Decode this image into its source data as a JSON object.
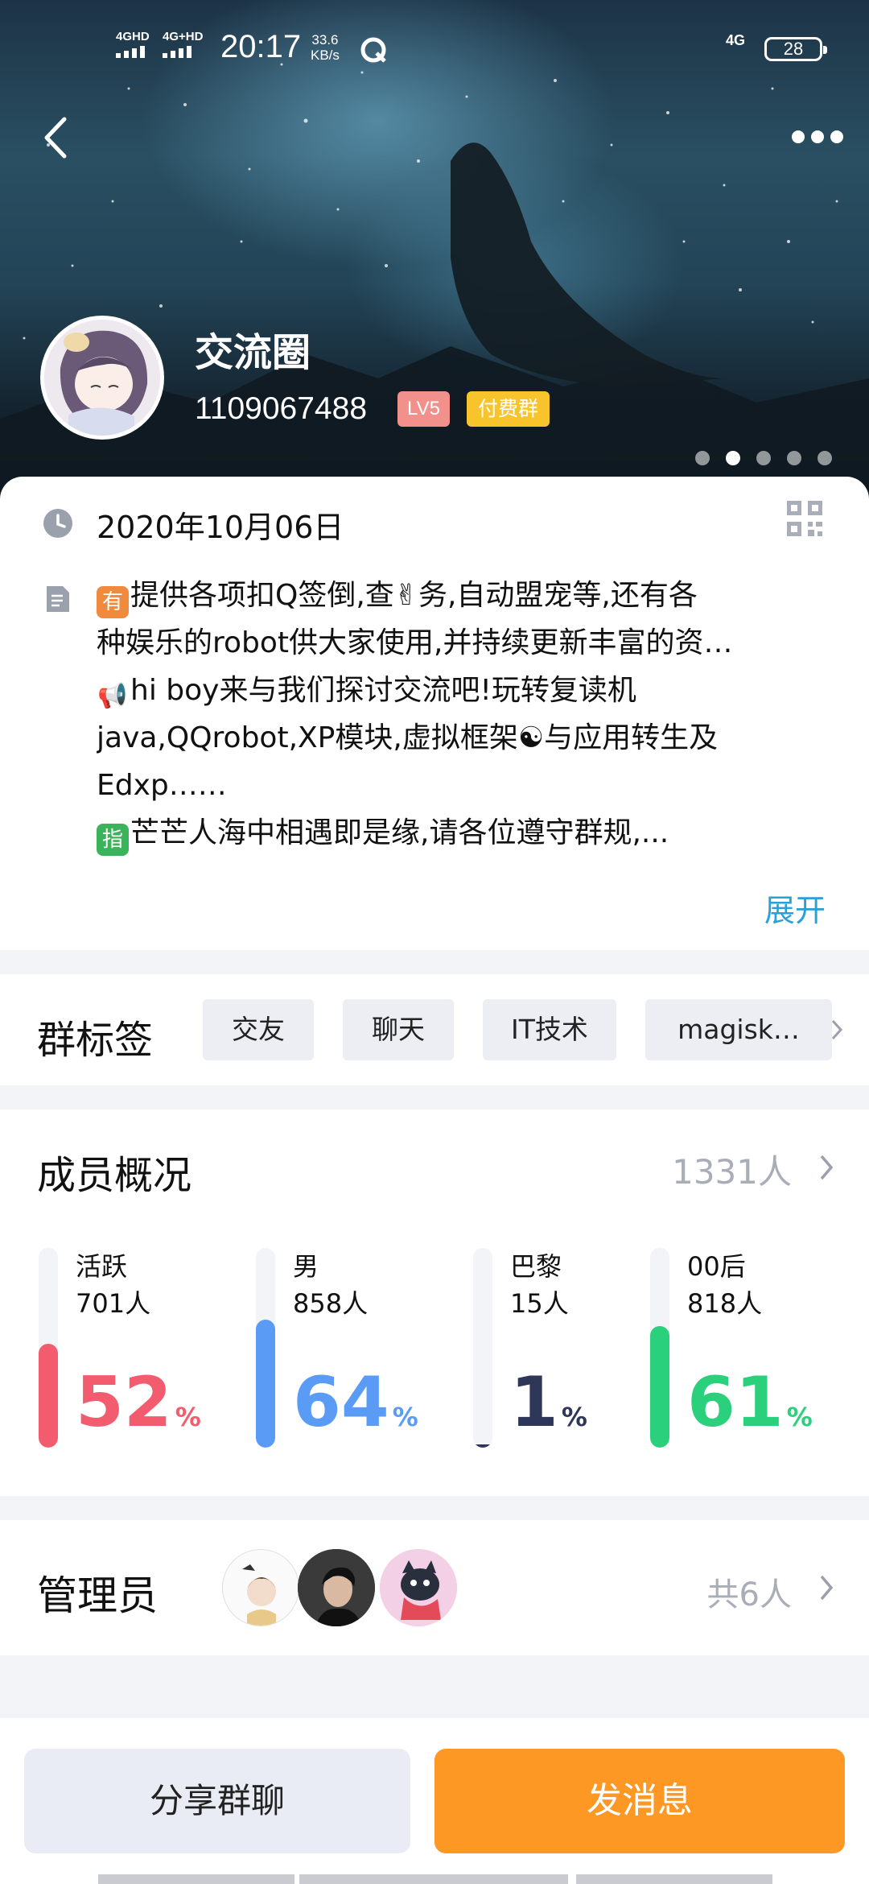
{
  "status_bar": {
    "signal_1": "4GHD",
    "signal_2": "4G+HD",
    "time": "20:17",
    "speed_value": "33.6",
    "speed_unit": "KB/s",
    "network": "4G",
    "battery": "28"
  },
  "header": {
    "back_icon": "chevron-left-icon",
    "more_icon": "more-dots-icon",
    "group_name": "交流圈",
    "group_id": "1109067488",
    "level_badge": "LV5",
    "paid_badge": "付费群",
    "carousel_pages": 5,
    "carousel_active_index": 1
  },
  "info": {
    "created_date": "2020年10月06日",
    "intro_lines": [
      {
        "emoji": "有",
        "emoji_color": "#f08a3c",
        "text": "提供各项扣Q签倒,查✌务,自动盟宠等,还有各"
      },
      {
        "emoji": "",
        "text": "种娱乐的robot供大家使用,并持续更新丰富的资…"
      },
      {
        "emoji": "📢",
        "emoji_color": "",
        "text": "hi boy来与我们探讨交流吧!玩转复读机"
      },
      {
        "emoji": "",
        "text": "java,QQrobot,XP模块,虚拟框架☯与应用转生及"
      },
      {
        "emoji": "",
        "text": "Edxp……"
      },
      {
        "emoji": "指",
        "emoji_color": "#3bb35a",
        "text": "芒芒人海中相遇即是缘,请各位遵守群规,..."
      }
    ],
    "expand_label": "展开"
  },
  "tags": {
    "title": "群标签",
    "items": [
      "交友",
      "聊天",
      "IT技术",
      "magisk…"
    ]
  },
  "members": {
    "title": "成员概况",
    "total": "1331人",
    "stats": [
      {
        "label": "活跃",
        "count": "701人",
        "percent": "52",
        "unit": "%",
        "color": "#f25c6e",
        "fraction": 0.52
      },
      {
        "label": "男",
        "count": "858人",
        "percent": "64",
        "unit": "%",
        "color": "#5a9bf5",
        "fraction": 0.64
      },
      {
        "label": "巴黎",
        "count": "15人",
        "percent": "1",
        "unit": "%",
        "color": "#2e3758",
        "fraction": 0.01
      },
      {
        "label": "00后",
        "count": "818人",
        "percent": "61",
        "unit": "%",
        "color": "#2ad07b",
        "fraction": 0.61
      }
    ]
  },
  "admins": {
    "title": "管理员",
    "count": "共6人"
  },
  "actions": {
    "share_label": "分享群聊",
    "send_label": "发消息"
  }
}
